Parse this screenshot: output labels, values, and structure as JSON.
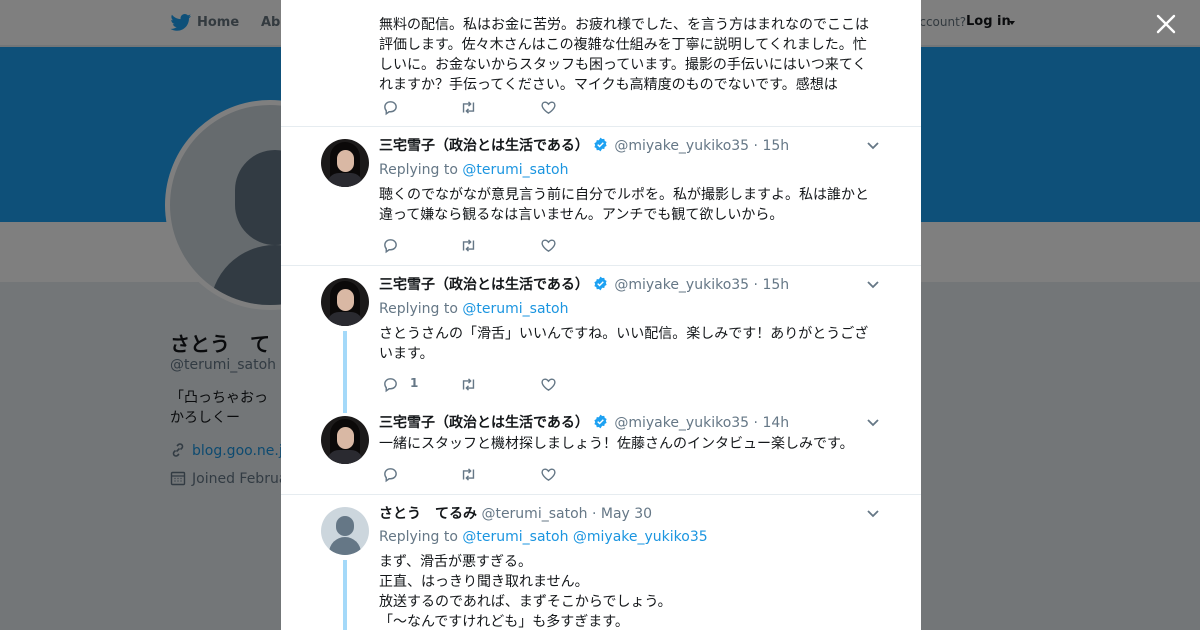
{
  "nav": {
    "home_label": "Home",
    "about_label": "Abo",
    "account_text": "account?",
    "login_label": "Log in"
  },
  "profile": {
    "name": "さとう　て",
    "handle": "@terumi_satoh",
    "bio": "「凸っちゃおっかろしくー",
    "link": "blog.goo.ne.jp",
    "joined": "Joined Februa"
  },
  "tweets": [
    {
      "text": "無料の配信。私はお金に苦労。お疲れ様でした、を言う方はまれなのでここは評価します。佐々木さんはこの複雑な仕組みを丁寧に説明してくれました。忙しいに。お金ないからスタッフも困っています。撮影の手伝いにはいつ来てくれますか？手伝ってください。マイクも高精度のものでないです。感想は"
    },
    {
      "name": "三宅雪子（政治とは生活である）",
      "handle": "@miyake_yukiko35",
      "time": "15h",
      "replying_prefix": "Replying to",
      "replying_to": "@terumi_satoh",
      "text": "聴くのでながなが意見言う前に自分でルポを。私が撮影しますよ。私は誰かと違って嫌なら観るなは言いません。アンチでも観て欲しいから。"
    },
    {
      "name": "三宅雪子（政治とは生活である）",
      "handle": "@miyake_yukiko35",
      "time": "15h",
      "replying_prefix": "Replying to",
      "replying_to": "@terumi_satoh",
      "text": "さとうさんの「滑舌」いいんですね。いい配信。楽しみです！ありがとうございます。",
      "reply_count": "1"
    },
    {
      "name": "三宅雪子（政治とは生活である）",
      "handle": "@miyake_yukiko35",
      "time": "14h",
      "text": "一緒にスタッフと機材探しましょう！佐藤さんのインタビュー楽しみです。"
    },
    {
      "name": "さとう　てるみ",
      "handle": "@terumi_satoh",
      "time": "May 30",
      "replying_prefix": "Replying to",
      "replying_to": "@terumi_satoh",
      "replying_to_2": "@miyake_yukiko35",
      "lines": [
        "まず、滑舌が悪すぎる。",
        "正直、はっきり聞き取れません。",
        "放送するのであれば、まずそこからでしょう。",
        "「〜なんですけれども」も多すぎます。"
      ]
    }
  ],
  "separator_dot": "·",
  "colors": {
    "accent": "#1da1f2",
    "link": "#1b95e0",
    "muted": "#657786",
    "thread": "#a4d9f9"
  },
  "icons": [
    "twitter-bird-icon",
    "close-icon",
    "verified-badge-icon",
    "reply-icon",
    "retweet-icon",
    "like-icon",
    "chevron-down-icon",
    "link-icon",
    "calendar-icon"
  ]
}
